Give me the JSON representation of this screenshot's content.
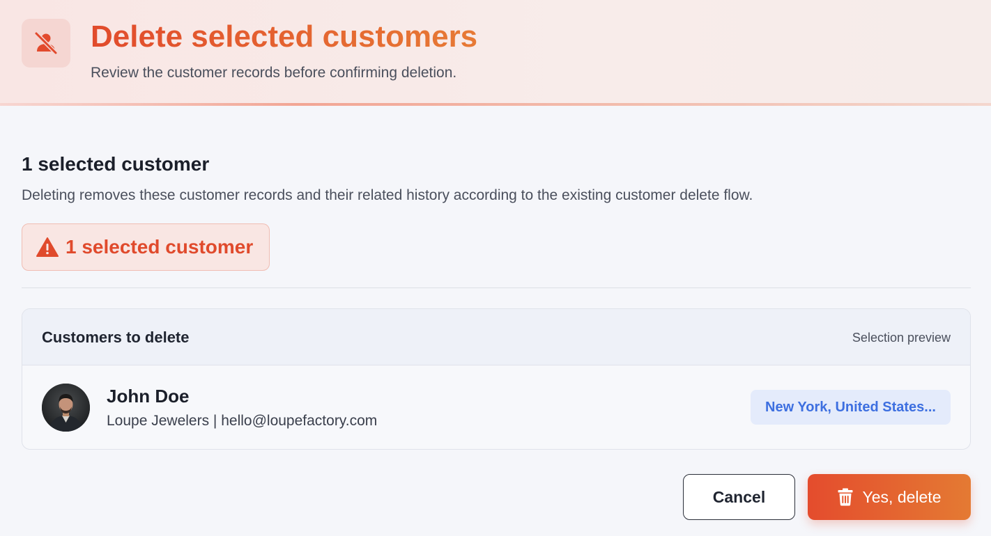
{
  "header": {
    "title": "Delete selected customers",
    "subtitle": "Review the customer records before confirming deletion.",
    "icon": "user-slash-icon"
  },
  "summary": {
    "title": "1 selected customer",
    "description": "Deleting removes these customer records and their related history according to the existing customer delete flow.",
    "badge_label": "1 selected customer",
    "badge_icon": "warning-triangle-icon"
  },
  "card": {
    "title": "Customers to delete",
    "note": "Selection preview"
  },
  "customers": [
    {
      "name": "John Doe",
      "detail": "Loupe Jewelers | hello@loupefactory.com",
      "location": "New York, United States..."
    }
  ],
  "actions": {
    "cancel_label": "Cancel",
    "delete_label": "Yes, delete",
    "delete_icon": "trash-icon"
  },
  "colors": {
    "accent": "#e14b2c",
    "accent_end": "#e77a35",
    "location_text": "#3d6fe0",
    "location_bg": "#e4ebfb"
  }
}
